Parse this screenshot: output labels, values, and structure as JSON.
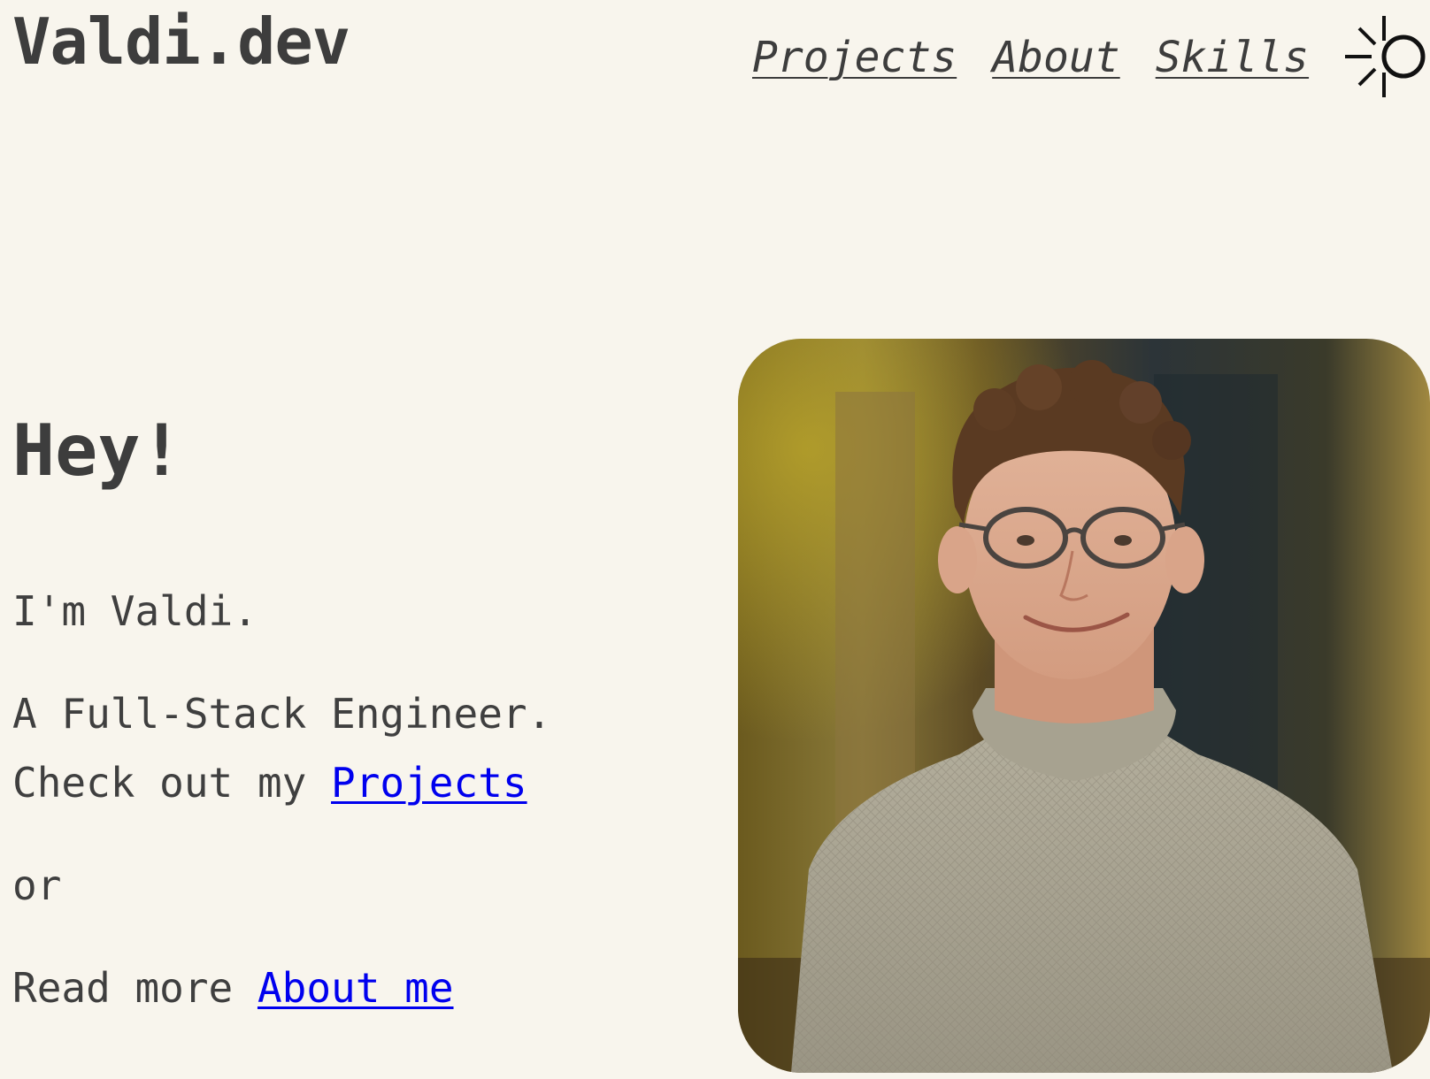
{
  "header": {
    "brand": "Valdi.dev",
    "nav": [
      {
        "label": "Projects"
      },
      {
        "label": "About"
      },
      {
        "label": "Skills"
      }
    ],
    "theme_toggle_icon": "sun-icon"
  },
  "hero": {
    "title": "Hey!",
    "intro": "I'm Valdi.",
    "role": "A Full-Stack Engineer.",
    "check_prefix": "Check out my ",
    "projects_link": "Projects",
    "or": "or",
    "read_prefix": "Read more ",
    "about_link": "About me"
  },
  "colors": {
    "background": "#f8f5ed",
    "text": "#3f3f3f",
    "link": "#0000ee"
  }
}
